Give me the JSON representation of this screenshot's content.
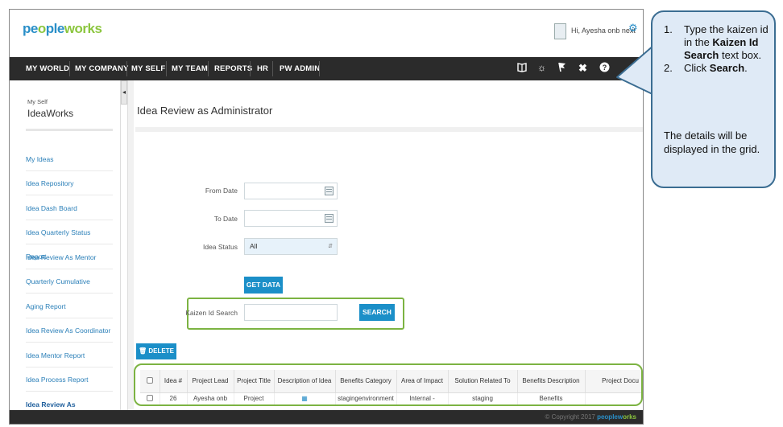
{
  "header": {
    "logo_part1": "pe",
    "logo_part2": "o",
    "logo_part3": "ple",
    "logo_part4": "works",
    "greeting": "Hi, Ayesha onb next"
  },
  "nav": {
    "items": [
      "MY WORLD",
      "MY COMPANY",
      "MY SELF",
      "MY TEAM",
      "REPORTS",
      "HR",
      "PW ADMIN"
    ]
  },
  "sidebar": {
    "breadcrumb": "My Self",
    "title": "IdeaWorks",
    "items": [
      "My Ideas",
      "Idea Repository",
      "Idea Dash Board",
      "Idea Quarterly Status Report",
      "Idea Review As Mentor",
      "Quarterly Cumulative",
      "Aging Report",
      "Idea Review As Coordinator",
      "Idea Mentor Report",
      "Idea Process Report",
      "Idea Review As Administrator"
    ]
  },
  "main": {
    "title": "Idea Review as Administrator",
    "from_date_label": "From Date",
    "to_date_label": "To Date",
    "idea_status_label": "Idea Status",
    "idea_status_value": "All",
    "get_data_label": "GET DATA",
    "kaizen_label": "Kaizen Id Search",
    "search_label": "SEARCH",
    "delete_label": "DELETE"
  },
  "grid": {
    "columns": [
      "Idea #",
      "Project Lead",
      "Project Title",
      "Description of Idea",
      "Benefits Category",
      "Area of Impact",
      "Solution Related To",
      "Benefits Description",
      "Project Docu"
    ],
    "row": [
      "26",
      "Ayesha onb",
      "Project",
      "",
      "stagingenvironment",
      "Internal -",
      "staging",
      "Benefits",
      ""
    ]
  },
  "footer": {
    "copyright": "© Copyright 2017",
    "logo": "peoplew",
    "logo2": "orks"
  },
  "callout": {
    "step1_num": "1.",
    "step1_a": "Type the kaizen id  in the ",
    "step1_bold": "Kaizen Id Search",
    "step1_b": " text box.",
    "step2_num": "2.",
    "step2_a": "Click ",
    "step2_bold": "Search",
    "step2_b": ".",
    "note": "The details  will be displayed in the grid."
  },
  "colors": {
    "accent": "#1b8fc8",
    "navbar": "#2b2b2b",
    "highlight": "#7cb342",
    "callout_fill": "#dfeaf6",
    "callout_border": "#3b6d92"
  },
  "icons": {
    "nav": [
      "book-icon",
      "lightbulb-icon",
      "flag-icon",
      "tools-icon",
      "help-icon"
    ],
    "header": [
      "avatar",
      "gear-icon"
    ]
  }
}
